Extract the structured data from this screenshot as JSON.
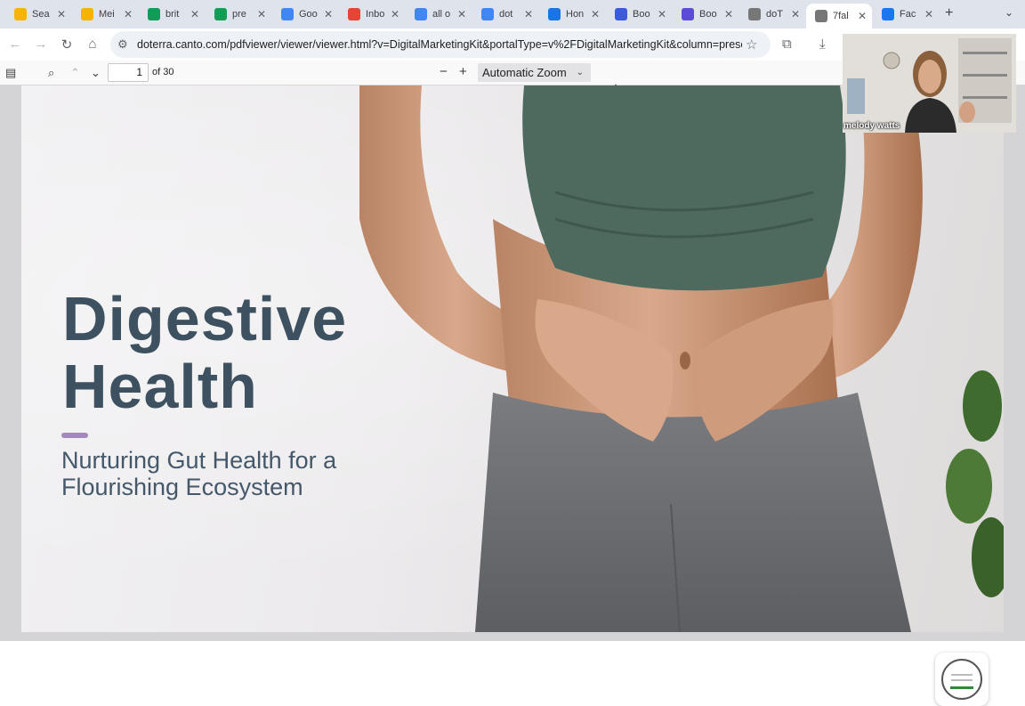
{
  "browser": {
    "tabs": [
      {
        "title": "Sea",
        "icon": "google-drive-icon",
        "color": "#f4b400"
      },
      {
        "title": "Mei",
        "icon": "google-slides-icon",
        "color": "#f4b400"
      },
      {
        "title": "brit",
        "icon": "google-sheets-icon",
        "color": "#0f9d58"
      },
      {
        "title": "pre",
        "icon": "google-sheets-icon",
        "color": "#0f9d58"
      },
      {
        "title": "Goo",
        "icon": "google-calendar-icon",
        "color": "#4285f4"
      },
      {
        "title": "Inbo",
        "icon": "gmail-icon",
        "color": "#ea4335"
      },
      {
        "title": "all o",
        "icon": "google-search-icon",
        "color": "#4285f4"
      },
      {
        "title": "dot",
        "icon": "google-search-icon",
        "color": "#4285f4"
      },
      {
        "title": "Hon",
        "icon": "canva-icon",
        "color": "#1a73e8"
      },
      {
        "title": "Boo",
        "icon": "book-icon",
        "color": "#3b5bdb"
      },
      {
        "title": "Boo",
        "icon": "chat-icon",
        "color": "#5b4bdb"
      },
      {
        "title": "doT",
        "icon": "pdf-icon",
        "color": "#777777"
      },
      {
        "title": "7fal",
        "icon": "pdf-icon",
        "color": "#777777"
      },
      {
        "title": "Fac",
        "icon": "facebook-icon",
        "color": "#1877f2"
      }
    ],
    "active_tab_index": 12,
    "url": "doterra.canto.com/pdfviewer/viewer/viewer.html?v=DigitalMarketingKit&portalType=v%2FDigitalMarketingKit&column=present..."
  },
  "pdf_toolbar": {
    "page_number": "1",
    "page_count": "of 30",
    "zoom": "Automatic Zoom"
  },
  "slide": {
    "title_line1": "Digestive",
    "title_line2": "Health",
    "subtitle_line1": "Nurturing Gut Health for a",
    "subtitle_line2": "Flourishing Ecosystem",
    "accent_color": "#a487bd",
    "title_color": "#3d5160"
  },
  "webcam": {
    "name": "melody watts"
  }
}
